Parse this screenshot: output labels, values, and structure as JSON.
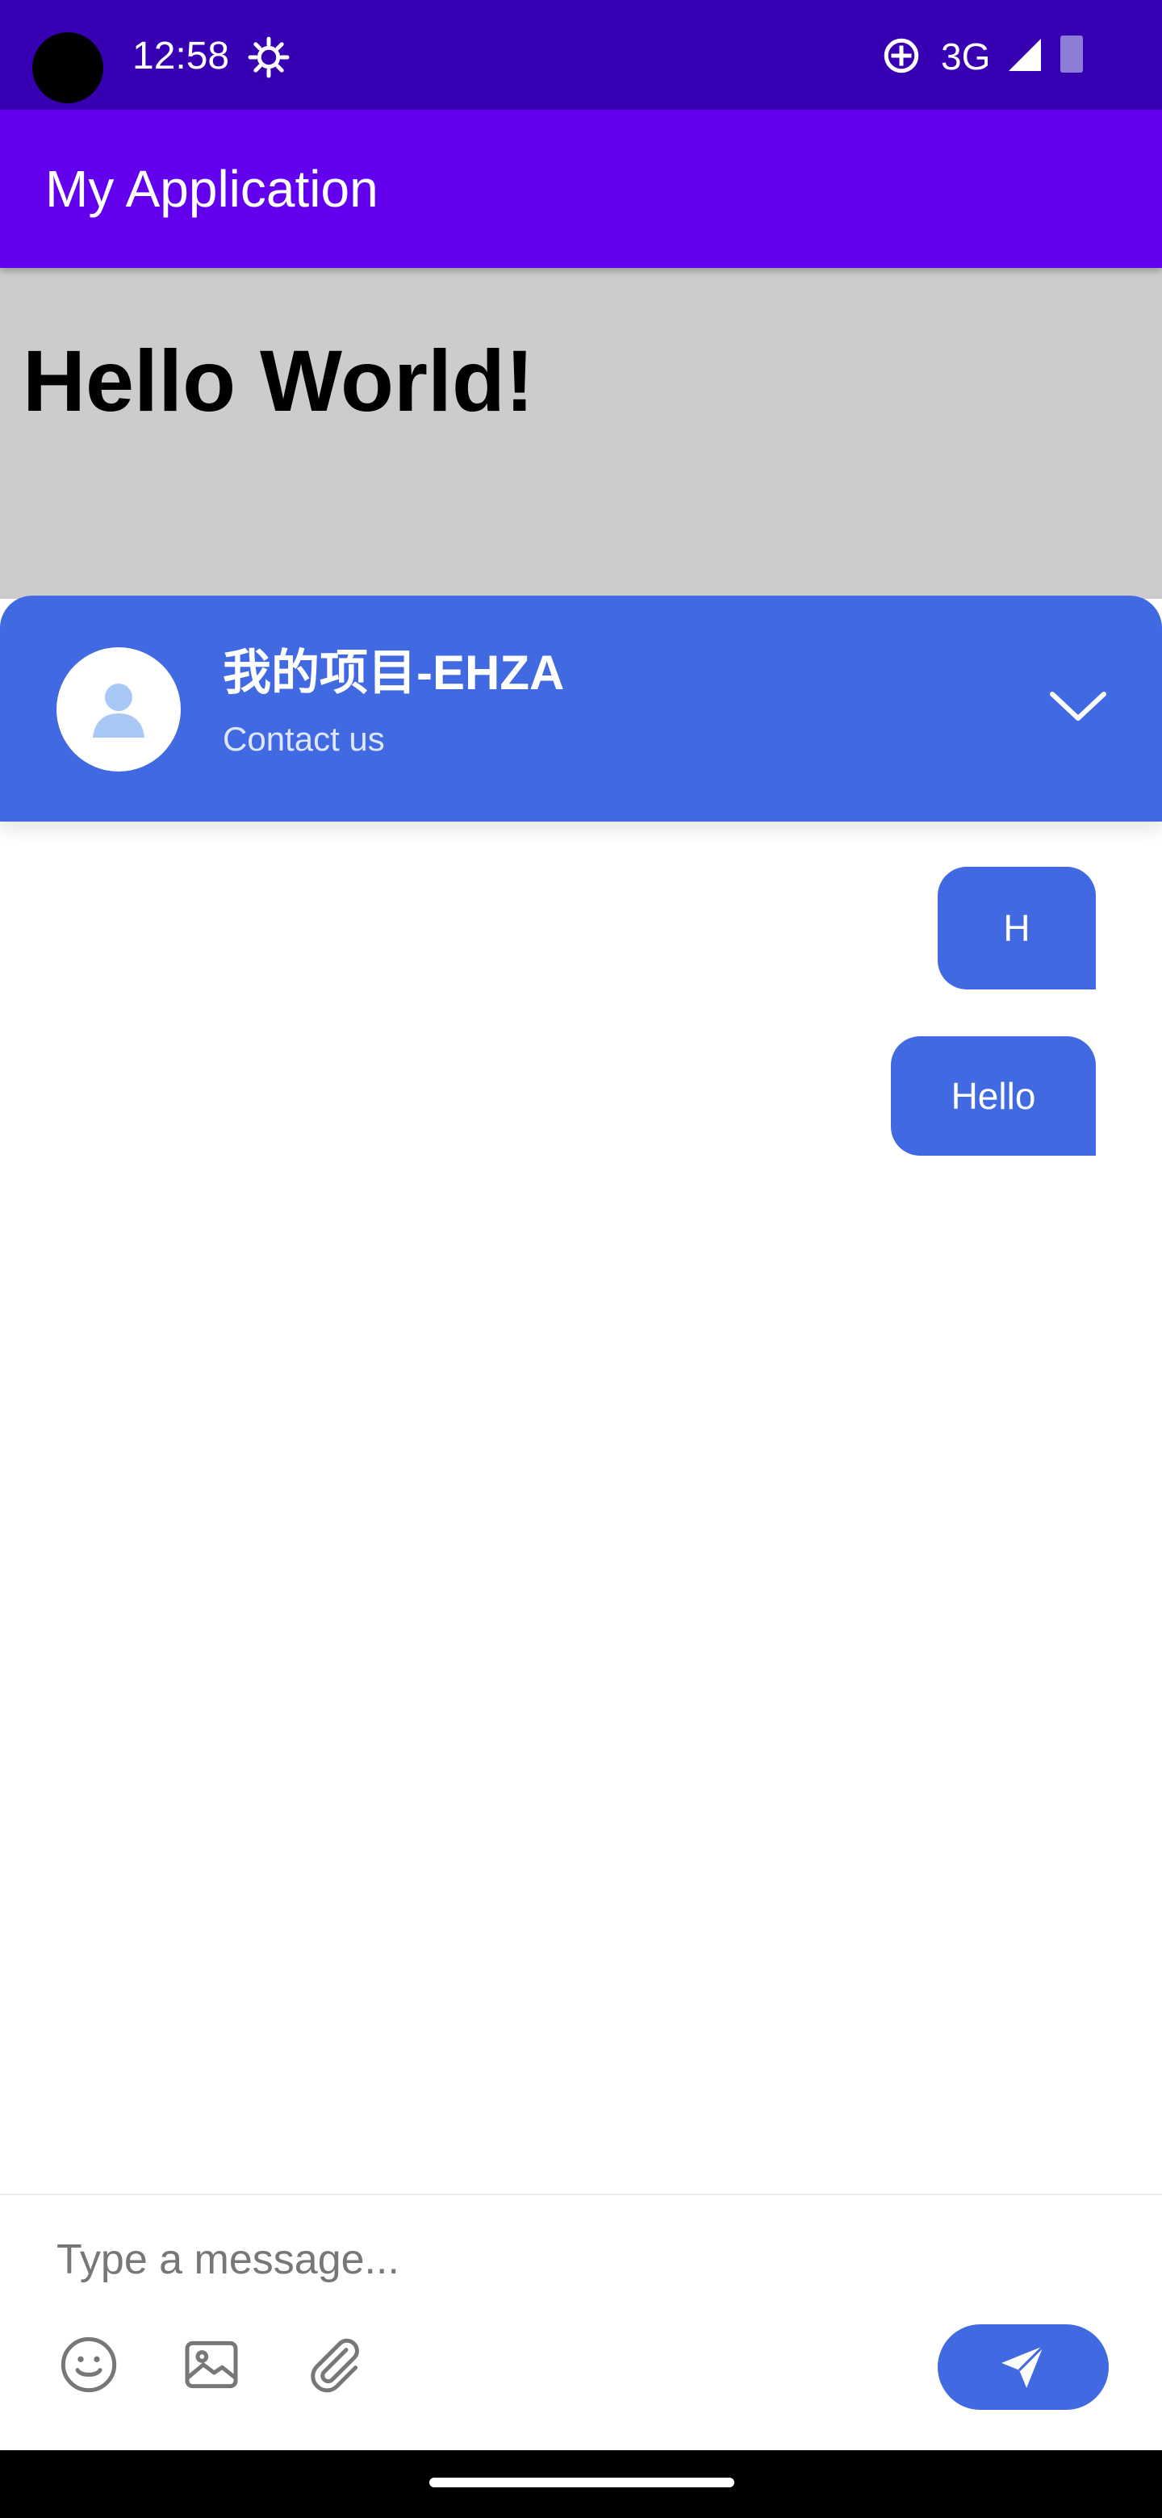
{
  "status_bar": {
    "time": "12:58",
    "network": "3G",
    "icons": [
      "settings-gear-icon",
      "screen-rotate-icon",
      "signal-icon",
      "battery-icon"
    ]
  },
  "app_bar": {
    "title": "My Application"
  },
  "content": {
    "heading": "Hello World!"
  },
  "chat": {
    "title": "我的项目-EHZA",
    "subtitle": "Contact us",
    "messages": [
      {
        "from": "user",
        "text": "H"
      },
      {
        "from": "user",
        "text": "Hello"
      }
    ],
    "composer": {
      "placeholder": "Type a message...",
      "tools": [
        "emoji-icon",
        "image-icon",
        "attachment-icon"
      ],
      "send_icon": "send-icon"
    }
  },
  "colors": {
    "status_bar": "#3700b3",
    "app_bar": "#6200ee",
    "content_background": "#cccccc",
    "chat_accent": "#4169e1"
  }
}
